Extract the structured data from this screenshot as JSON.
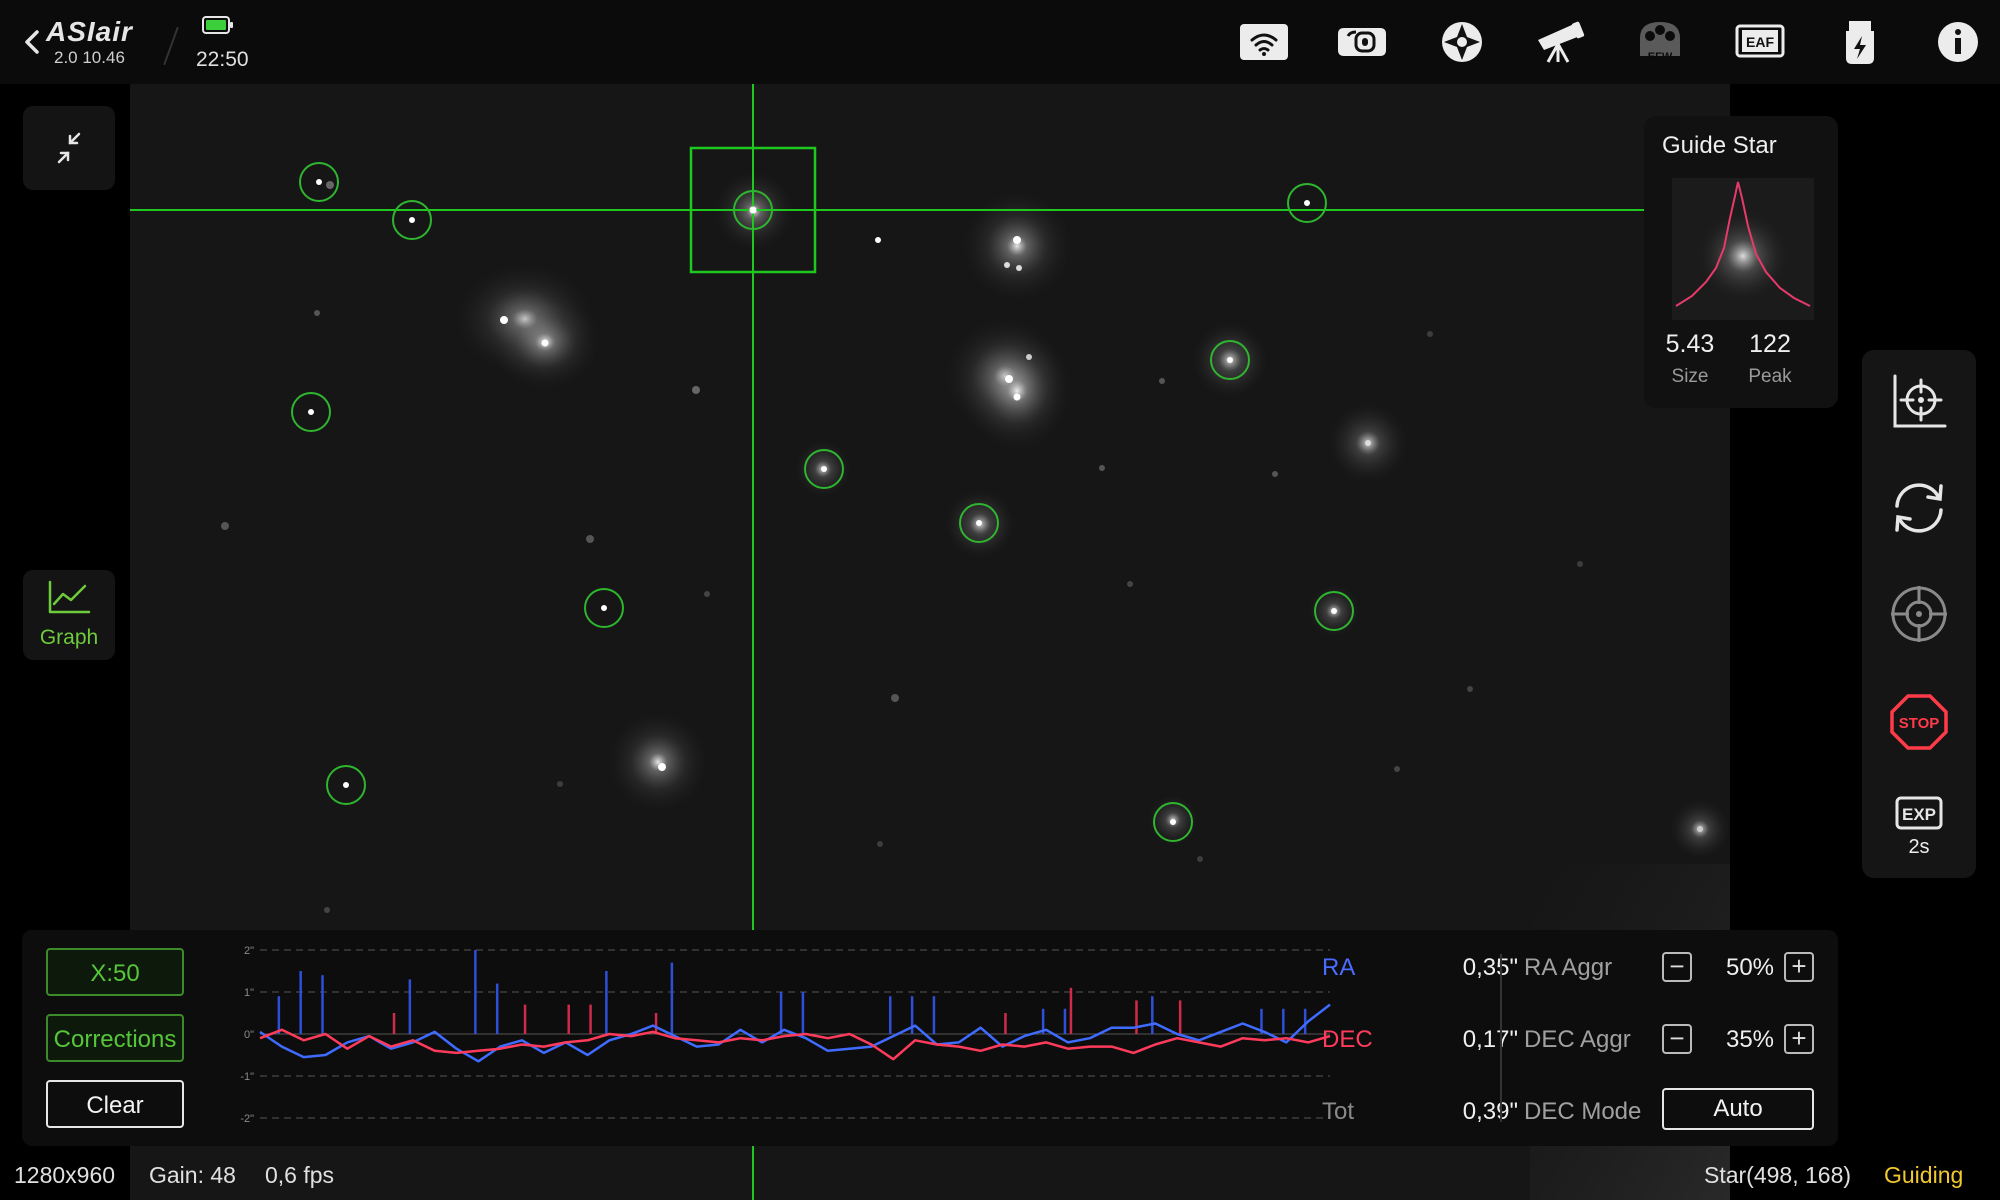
{
  "header": {
    "brand": "ASIair",
    "version": "2.0 10.46",
    "time": "22:50",
    "icons": [
      "wifi-icon",
      "camera-icon",
      "guide-icon",
      "telescope-icon",
      "efw-icon",
      "eaf-icon",
      "usb-power-icon",
      "info-icon"
    ]
  },
  "left_tools": {
    "graph_label": "Graph"
  },
  "guide_star": {
    "title": "Guide Star",
    "size_value": "5.43",
    "size_label": "Size",
    "peak_value": "122",
    "peak_label": "Peak"
  },
  "right_tools": {
    "icons": [
      "target-plot-icon",
      "refresh-icon",
      "crosshair-icon",
      "stop-icon",
      "exposure-icon"
    ],
    "stop_label": "STOP",
    "exp_badge": "EXP",
    "exposure": "2s"
  },
  "graph": {
    "x_scale_label": "X:50",
    "corrections_label": "Corrections",
    "clear_label": "Clear",
    "y_ticks": [
      "2\"",
      "1\"",
      "0\"",
      "-1\"",
      "-2\""
    ],
    "ra_label": "RA",
    "ra_value": "0,35\"",
    "dec_label": "DEC",
    "dec_value": "0,17\"",
    "tot_label": "Tot",
    "tot_value": "0,39\"",
    "ra_aggr_label": "RA Aggr",
    "ra_aggr_value": "50%",
    "dec_aggr_label": "DEC Aggr",
    "dec_aggr_value": "35%",
    "dec_mode_label": "DEC Mode",
    "dec_mode_value": "Auto",
    "minus": "−",
    "plus": "+",
    "colors": {
      "ra": "#3f6bff",
      "dec": "#ff3b5c"
    }
  },
  "chart_data": {
    "type": "line",
    "ylim": [
      -2,
      2
    ],
    "x": [
      1,
      2,
      3,
      4,
      5,
      6,
      7,
      8,
      9,
      10,
      11,
      12,
      13,
      14,
      15,
      16,
      17,
      18,
      19,
      20,
      21,
      22,
      23,
      24,
      25,
      26,
      27,
      28,
      29,
      30,
      31,
      32,
      33,
      34,
      35,
      36,
      37,
      38,
      39,
      40,
      41,
      42,
      43,
      44,
      45,
      46,
      47,
      48,
      49,
      50
    ],
    "series": [
      {
        "name": "RA",
        "color": "#3f6bff",
        "values": [
          0.05,
          -0.3,
          -0.55,
          -0.5,
          -0.2,
          -0.05,
          -0.35,
          -0.2,
          0.05,
          -0.35,
          -0.65,
          -0.3,
          -0.15,
          -0.45,
          -0.2,
          -0.5,
          -0.15,
          0.0,
          0.2,
          -0.05,
          -0.3,
          -0.25,
          0.1,
          -0.2,
          0.1,
          -0.1,
          -0.4,
          -0.35,
          -0.3,
          -0.05,
          0.2,
          -0.25,
          -0.2,
          0.15,
          -0.3,
          -0.05,
          0.1,
          -0.2,
          -0.1,
          0.15,
          0.15,
          0.25,
          0.0,
          -0.15,
          0.05,
          0.25,
          0.05,
          -0.2,
          0.3,
          0.7
        ]
      },
      {
        "name": "DEC",
        "color": "#ff3b5c",
        "values": [
          -0.1,
          0.1,
          -0.15,
          0.0,
          -0.35,
          -0.05,
          -0.3,
          -0.15,
          -0.4,
          -0.45,
          -0.4,
          -0.35,
          -0.25,
          -0.3,
          -0.2,
          -0.15,
          0.0,
          -0.05,
          0.05,
          -0.1,
          -0.15,
          -0.2,
          -0.1,
          -0.15,
          -0.05,
          0.0,
          -0.1,
          0.0,
          -0.25,
          -0.6,
          -0.15,
          -0.25,
          -0.3,
          -0.4,
          -0.25,
          -0.3,
          -0.2,
          -0.35,
          -0.3,
          -0.3,
          -0.45,
          -0.25,
          -0.1,
          -0.2,
          -0.3,
          -0.1,
          -0.15,
          -0.1,
          -0.2,
          -0.05
        ]
      }
    ],
    "ra_corrections": [
      0,
      0.9,
      1.5,
      1.4,
      0,
      0,
      0,
      1.3,
      0,
      0,
      2,
      1.2,
      0,
      0,
      0,
      0,
      1.5,
      0,
      0,
      1.7,
      0,
      0,
      0,
      0,
      1.0,
      1.0,
      0,
      0,
      0,
      0.9,
      0.9,
      0.9,
      0,
      0,
      0,
      0,
      0.6,
      0.6,
      0,
      0,
      0,
      0.9,
      0,
      0,
      0,
      0,
      0.6,
      0.6,
      0.6,
      0
    ],
    "dec_corrections": [
      0,
      0,
      0,
      0,
      0,
      0,
      0.5,
      0,
      0,
      0,
      0,
      0,
      0.7,
      0,
      0.7,
      0.7,
      0,
      0,
      0.5,
      0,
      0,
      0,
      0,
      0,
      0,
      0,
      0,
      0,
      0,
      0,
      0,
      0,
      0,
      0,
      0.5,
      0,
      0,
      1.1,
      0,
      0,
      0.8,
      0,
      0.8,
      0,
      0,
      0,
      0,
      0,
      0,
      0
    ]
  },
  "status": {
    "resolution": "1280x960",
    "gain": "Gain: 48",
    "fps": "0,6 fps",
    "star": "Star(498, 168)",
    "state": "Guiding"
  }
}
